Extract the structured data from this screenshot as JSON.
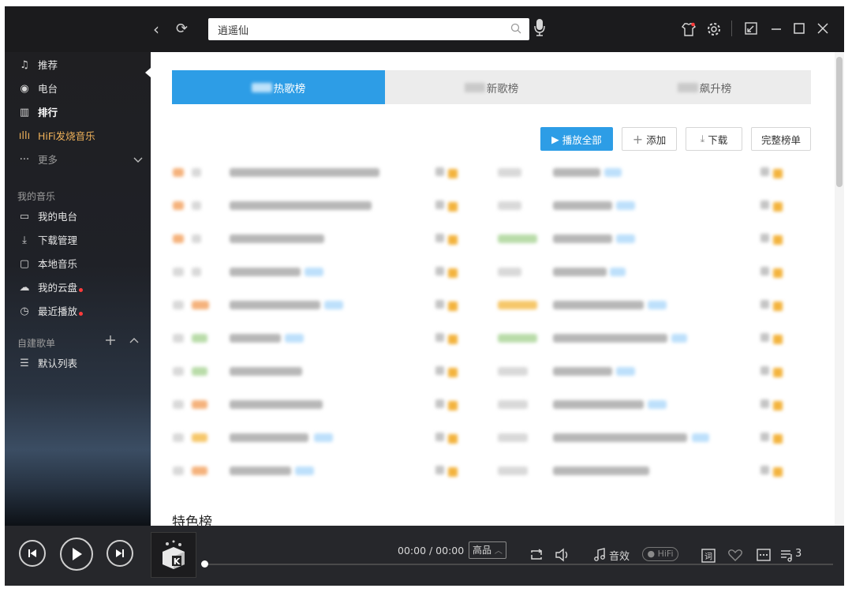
{
  "titlebar": {
    "back_icon": "‹",
    "refresh_icon": "⟳",
    "search_value": "逍遥仙",
    "search_icon": "⚲",
    "right_icons": {
      "skin": "skin-icon",
      "settings": "gear-icon",
      "mini": "mini-mode-icon",
      "minimize": "minimize-icon",
      "maximize": "maximize-icon",
      "close": "close-icon"
    }
  },
  "sidebar": {
    "items": [
      {
        "label": "推荐",
        "icon": "♫"
      },
      {
        "label": "电台",
        "icon": "◉"
      },
      {
        "label": "排行",
        "icon": "▥"
      },
      {
        "label": "HiFi发烧音乐",
        "icon": "ıllı"
      },
      {
        "label": "更多",
        "icon": "···"
      }
    ],
    "my_music_title": "我的音乐",
    "my_music": [
      {
        "label": "我的电台",
        "icon": "▭"
      },
      {
        "label": "下载管理",
        "icon": "⤓"
      },
      {
        "label": "本地音乐",
        "icon": "▢"
      },
      {
        "label": "我的云盘",
        "icon": "☁"
      },
      {
        "label": "最近播放",
        "icon": "◷"
      }
    ],
    "playlist_title": "自建歌单",
    "playlists": [
      {
        "label": "默认列表",
        "icon": "☰"
      }
    ]
  },
  "main": {
    "tabs": [
      {
        "label": "热歌榜",
        "active": true
      },
      {
        "label": "新歌榜",
        "active": false
      },
      {
        "label": "飙升榜",
        "active": false
      }
    ],
    "actions": {
      "play_all": "播放全部",
      "add": "添加",
      "download": "下载",
      "full_list": "完整榜单"
    },
    "section_title": "特色榜"
  },
  "player": {
    "time": "00:00 / 00:00",
    "quality": "高品",
    "effect": "音效",
    "hifi": "HiFi",
    "queue_count": "3"
  },
  "colors": {
    "accent": "#2d9de6",
    "sidebar_bg": "#1f1f22",
    "hifi": "#f0b25a",
    "player_bg": "#26272b"
  }
}
